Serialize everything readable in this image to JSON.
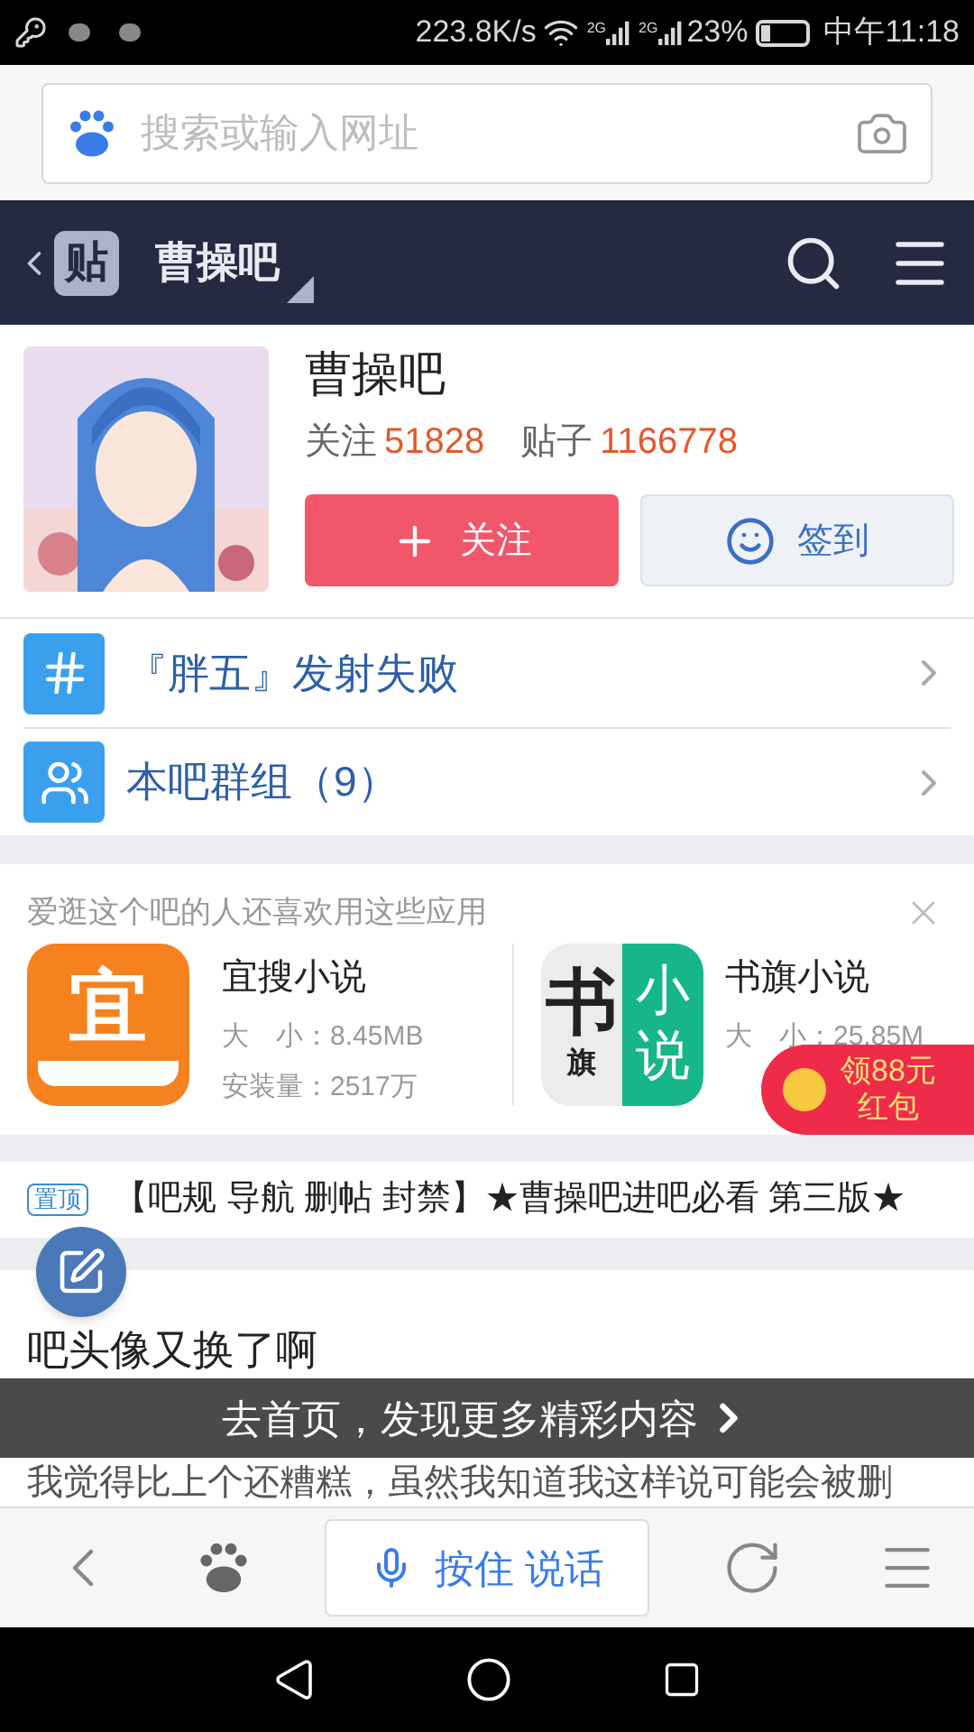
{
  "status_bar": {
    "speed": "223.8K/s",
    "sim_labels": [
      "2G",
      "2G"
    ],
    "battery": "23%",
    "time": "中午11:18"
  },
  "search": {
    "placeholder": "搜索或输入网址"
  },
  "nav": {
    "badge": "贴",
    "title": "曹操吧"
  },
  "forum": {
    "name": "曹操吧",
    "follow_label": "关注",
    "follow_count": "51828",
    "posts_label": "贴子",
    "posts_count": "1166778",
    "follow_button": "关注",
    "signin_button": "签到"
  },
  "links": [
    {
      "kind": "hash",
      "label": "『胖五』发射失败"
    },
    {
      "kind": "group",
      "label": "本吧群组（9）"
    }
  ],
  "apps": {
    "title": "爱逛这个吧的人还喜欢用这些应用",
    "items": [
      {
        "kind": "yi",
        "icon_text": "宜",
        "name": "宜搜小说",
        "size": "大　小：8.45MB",
        "installs": "安装量：2517万"
      },
      {
        "kind": "shuqi",
        "icon_text": "书",
        "icon_sub": "旗",
        "icon_side": "小说",
        "name": "书旗小说",
        "size": "大　小：25.85M"
      }
    ]
  },
  "red_packet": {
    "line1": "领88元",
    "line2": "红包"
  },
  "pinned": {
    "badge": "置顶",
    "title": "【吧规 导航 删帖 封禁】★曹操吧进吧必看 第三版★"
  },
  "post": {
    "title": "吧头像又换了啊",
    "body": "我觉得比上个还糟糕，虽然我知道我这样说可能会被删"
  },
  "banner": "去首页，发现更多精彩内容",
  "bottom_bar": {
    "voice": "按住 说话"
  }
}
